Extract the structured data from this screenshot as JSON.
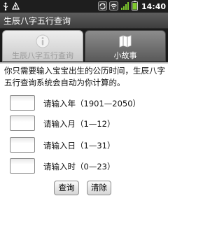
{
  "status_bar": {
    "time": "14:40",
    "left_icons": [
      "usb-icon",
      "debug-icon"
    ],
    "right_icons": [
      "sync-icon",
      "wifi-icon",
      "signal-icon",
      "battery-icon"
    ]
  },
  "app": {
    "title": "生辰八字五行查询"
  },
  "tabs": [
    {
      "label": "生辰八字五行查询",
      "icon": "info-icon",
      "selected": true
    },
    {
      "label": "小故事",
      "icon": "map-icon",
      "selected": false
    }
  ],
  "main": {
    "description": "你只需要输入宝宝出生的公历时间，生辰八字五行查询系统会自动为你计算的。",
    "fields": [
      {
        "label": "请输入年（1901—2050）",
        "value": "",
        "placeholder": ""
      },
      {
        "label": "请输入月（1—12）",
        "value": "",
        "placeholder": ""
      },
      {
        "label": "请输入日（1—31）",
        "value": "",
        "placeholder": ""
      },
      {
        "label": "请输入时（0—23）",
        "value": "",
        "placeholder": ""
      }
    ],
    "buttons": {
      "query": "查询",
      "clear": "清除"
    }
  },
  "colors": {
    "status_bar_bg": "#1e1e1e",
    "title_bar_bg": "#4a4a4a",
    "tab_selected_bg": "#dcdcdc",
    "tab_unselected_bg": "#6e6e6e",
    "battery_green": "#7ec82c"
  }
}
